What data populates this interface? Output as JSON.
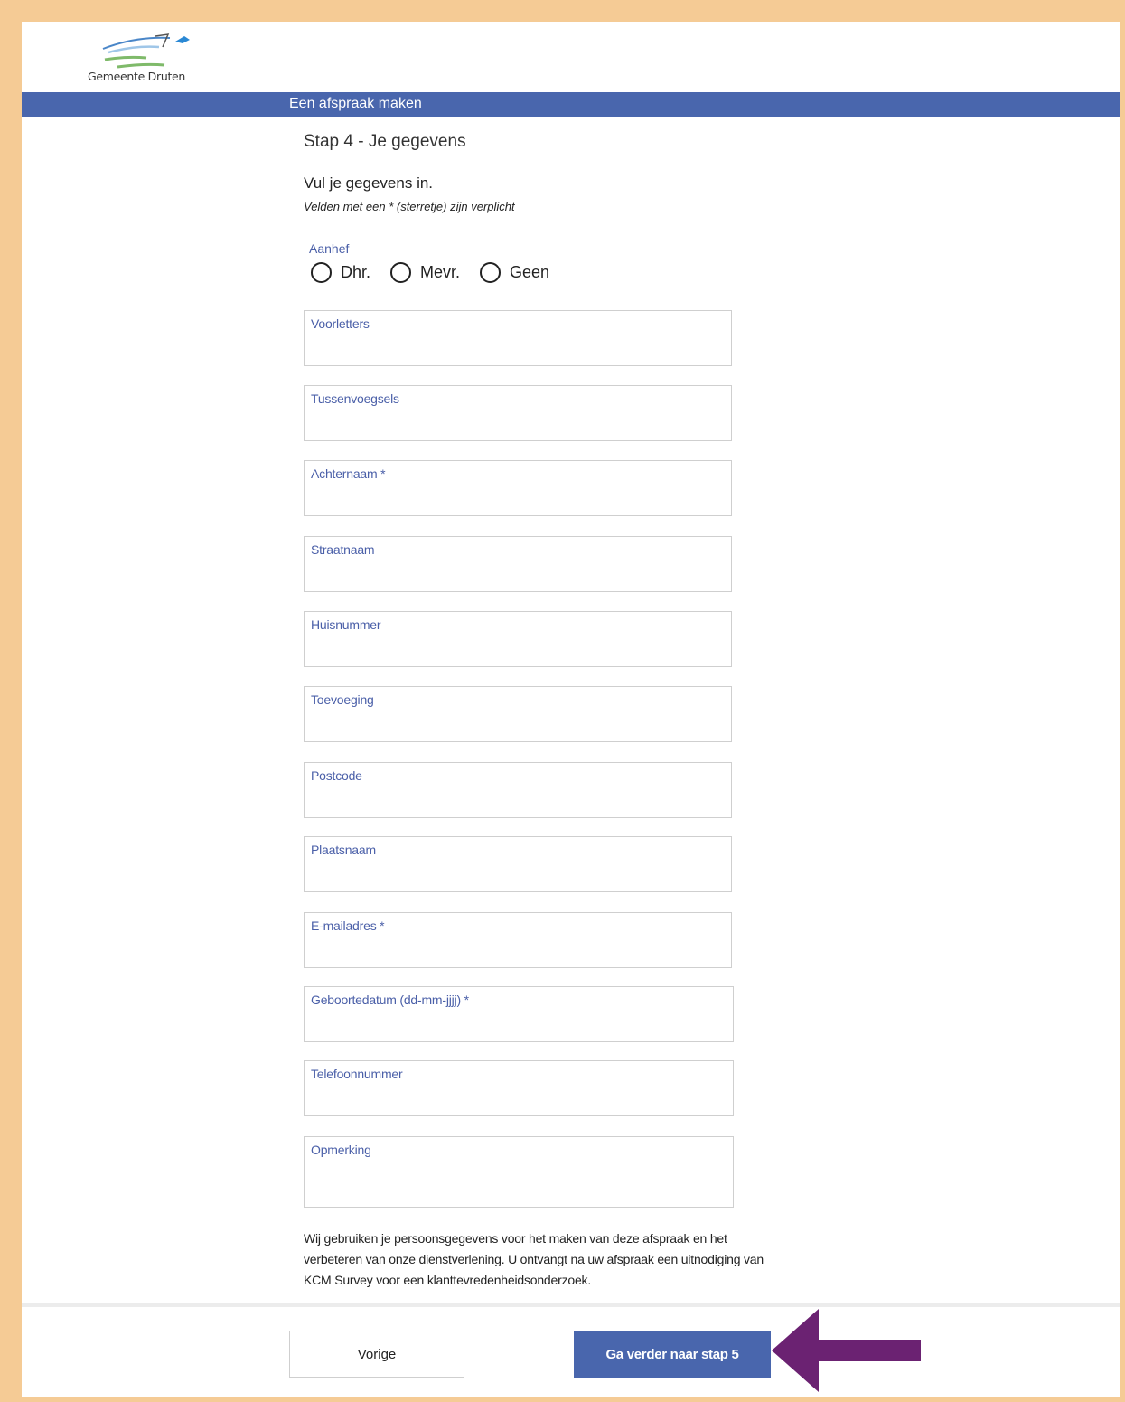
{
  "brand": {
    "name": "Gemeente Druten"
  },
  "header": {
    "title": "Een afspraak maken"
  },
  "step": {
    "title": "Stap 4 - Je gegevens",
    "intro": "Vul je gegevens in.",
    "required_note": "Velden met een * (sterretje) zijn verplicht"
  },
  "salutation": {
    "label": "Aanhef",
    "options": [
      "Dhr.",
      "Mevr.",
      "Geen"
    ]
  },
  "fields": [
    {
      "label": "Voorletters",
      "value": ""
    },
    {
      "label": "Tussenvoegsels",
      "value": ""
    },
    {
      "label": "Achternaam *",
      "value": ""
    },
    {
      "label": "Straatnaam",
      "value": ""
    },
    {
      "label": "Huisnummer",
      "value": ""
    },
    {
      "label": "Toevoeging",
      "value": ""
    },
    {
      "label": "Postcode",
      "value": ""
    },
    {
      "label": "Plaatsnaam",
      "value": ""
    },
    {
      "label": "E-mailadres *",
      "value": ""
    },
    {
      "label": "Geboortedatum (dd-mm-jjjj) *",
      "value": ""
    },
    {
      "label": "Telefoonnummer",
      "value": ""
    },
    {
      "label": "Opmerking",
      "value": ""
    }
  ],
  "privacy_text": "Wij gebruiken je persoonsgegevens voor het maken van deze afspraak en het verbeteren van onze dienstverlening. U ontvangt na uw afspraak een uitnodiging van KCM Survey voor een klanttevredenheidsonderzoek.",
  "footer": {
    "prev_label": "Vorige",
    "next_label": "Ga verder naar stap 5"
  },
  "colors": {
    "page_border": "#f5cb95",
    "primary": "#4966ad",
    "label_text": "#4a5fa8",
    "arrow": "#6b2272"
  }
}
